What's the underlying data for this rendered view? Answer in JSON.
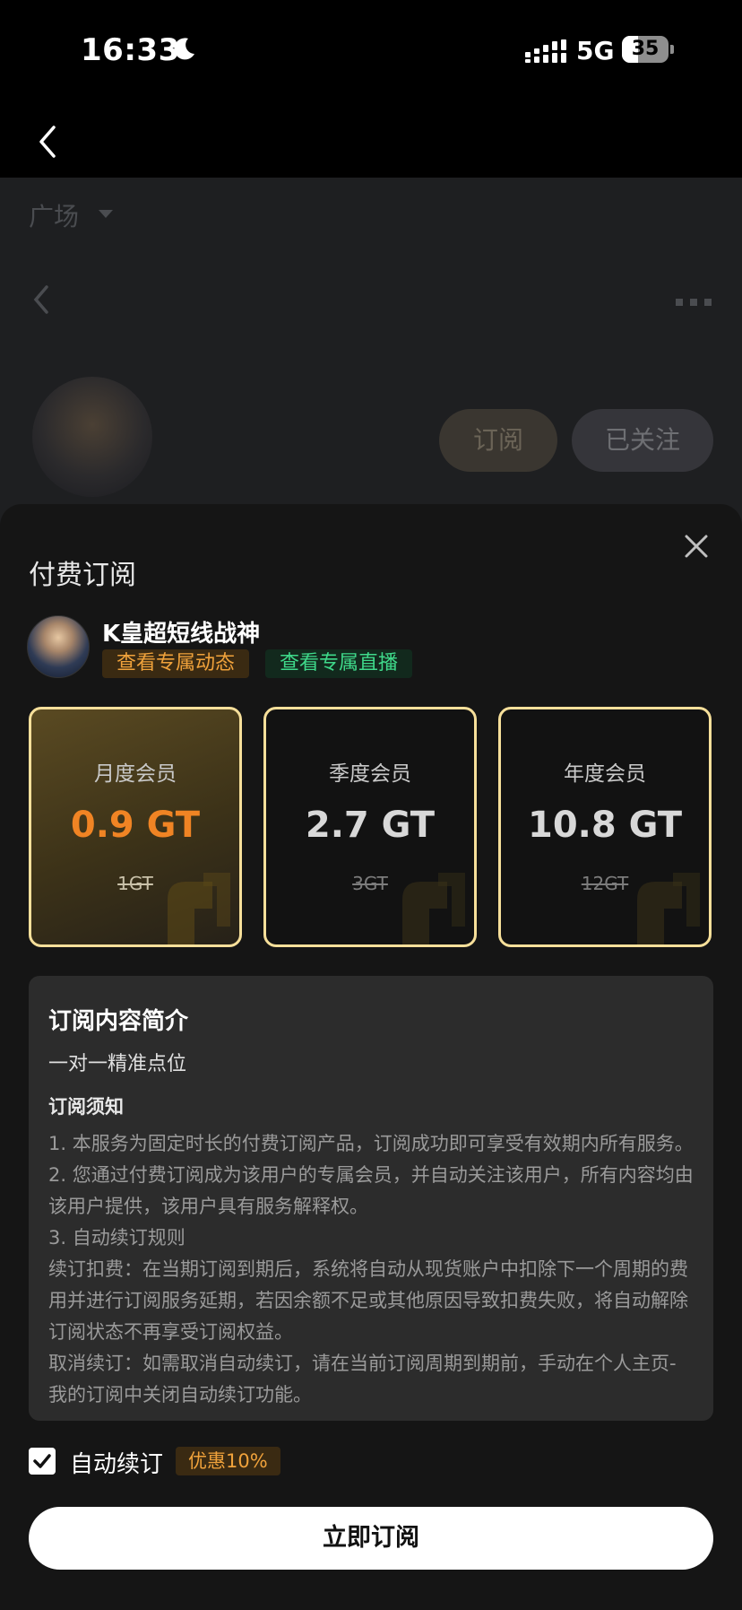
{
  "status_bar": {
    "time": "16:33",
    "network": "5G",
    "battery_level": "35",
    "battery_fraction": 0.35
  },
  "background": {
    "tab_label": "广场",
    "subscribe_label": "订阅",
    "follow_label": "已关注"
  },
  "sheet": {
    "title": "付费订阅",
    "creator_name": "K皇超短线战神",
    "tags": [
      {
        "label": "查看专属动态",
        "color": "#f0a23b"
      },
      {
        "label": "查看专属直播",
        "color": "#3fd98a"
      }
    ],
    "plans": [
      {
        "name": "月度会员",
        "price": "0.9 GT",
        "original": "1GT",
        "selected": true
      },
      {
        "name": "季度会员",
        "price": "2.7 GT",
        "original": "3GT",
        "selected": false
      },
      {
        "name": "年度会员",
        "price": "10.8 GT",
        "original": "12GT",
        "selected": false
      }
    ],
    "info": {
      "title": "订阅内容简介",
      "subtitle": "一对一精准点位",
      "notice_title": "订阅须知",
      "lines": [
        "1. 本服务为固定时长的付费订阅产品，订阅成功即可享受有效期内所有服务。",
        "2. 您通过付费订阅成为该用户的专属会员，并自动关注该用户，所有内容均由该用户提供，该用户具有服务解释权。",
        "3. 自动续订规则",
        "续订扣费：在当期订阅到期后，系统将自动从现货账户中扣除下一个周期的费用并进行订阅服务延期，若因余额不足或其他原因导致扣费失败，将自动解除订阅状态不再享受订阅权益。",
        "取消续订：如需取消自动续订，请在当前订阅周期到期前，手动在个人主页-我的订阅中关闭自动续订功能。"
      ]
    },
    "auto_renew": {
      "label": "自动续订",
      "checked": true,
      "discount": "优惠10%"
    },
    "cta_label": "立即订阅"
  },
  "colors": {
    "accent_orange": "#f08424",
    "plan_border": "#f6df9a",
    "tag_green": "#3fd98a"
  }
}
